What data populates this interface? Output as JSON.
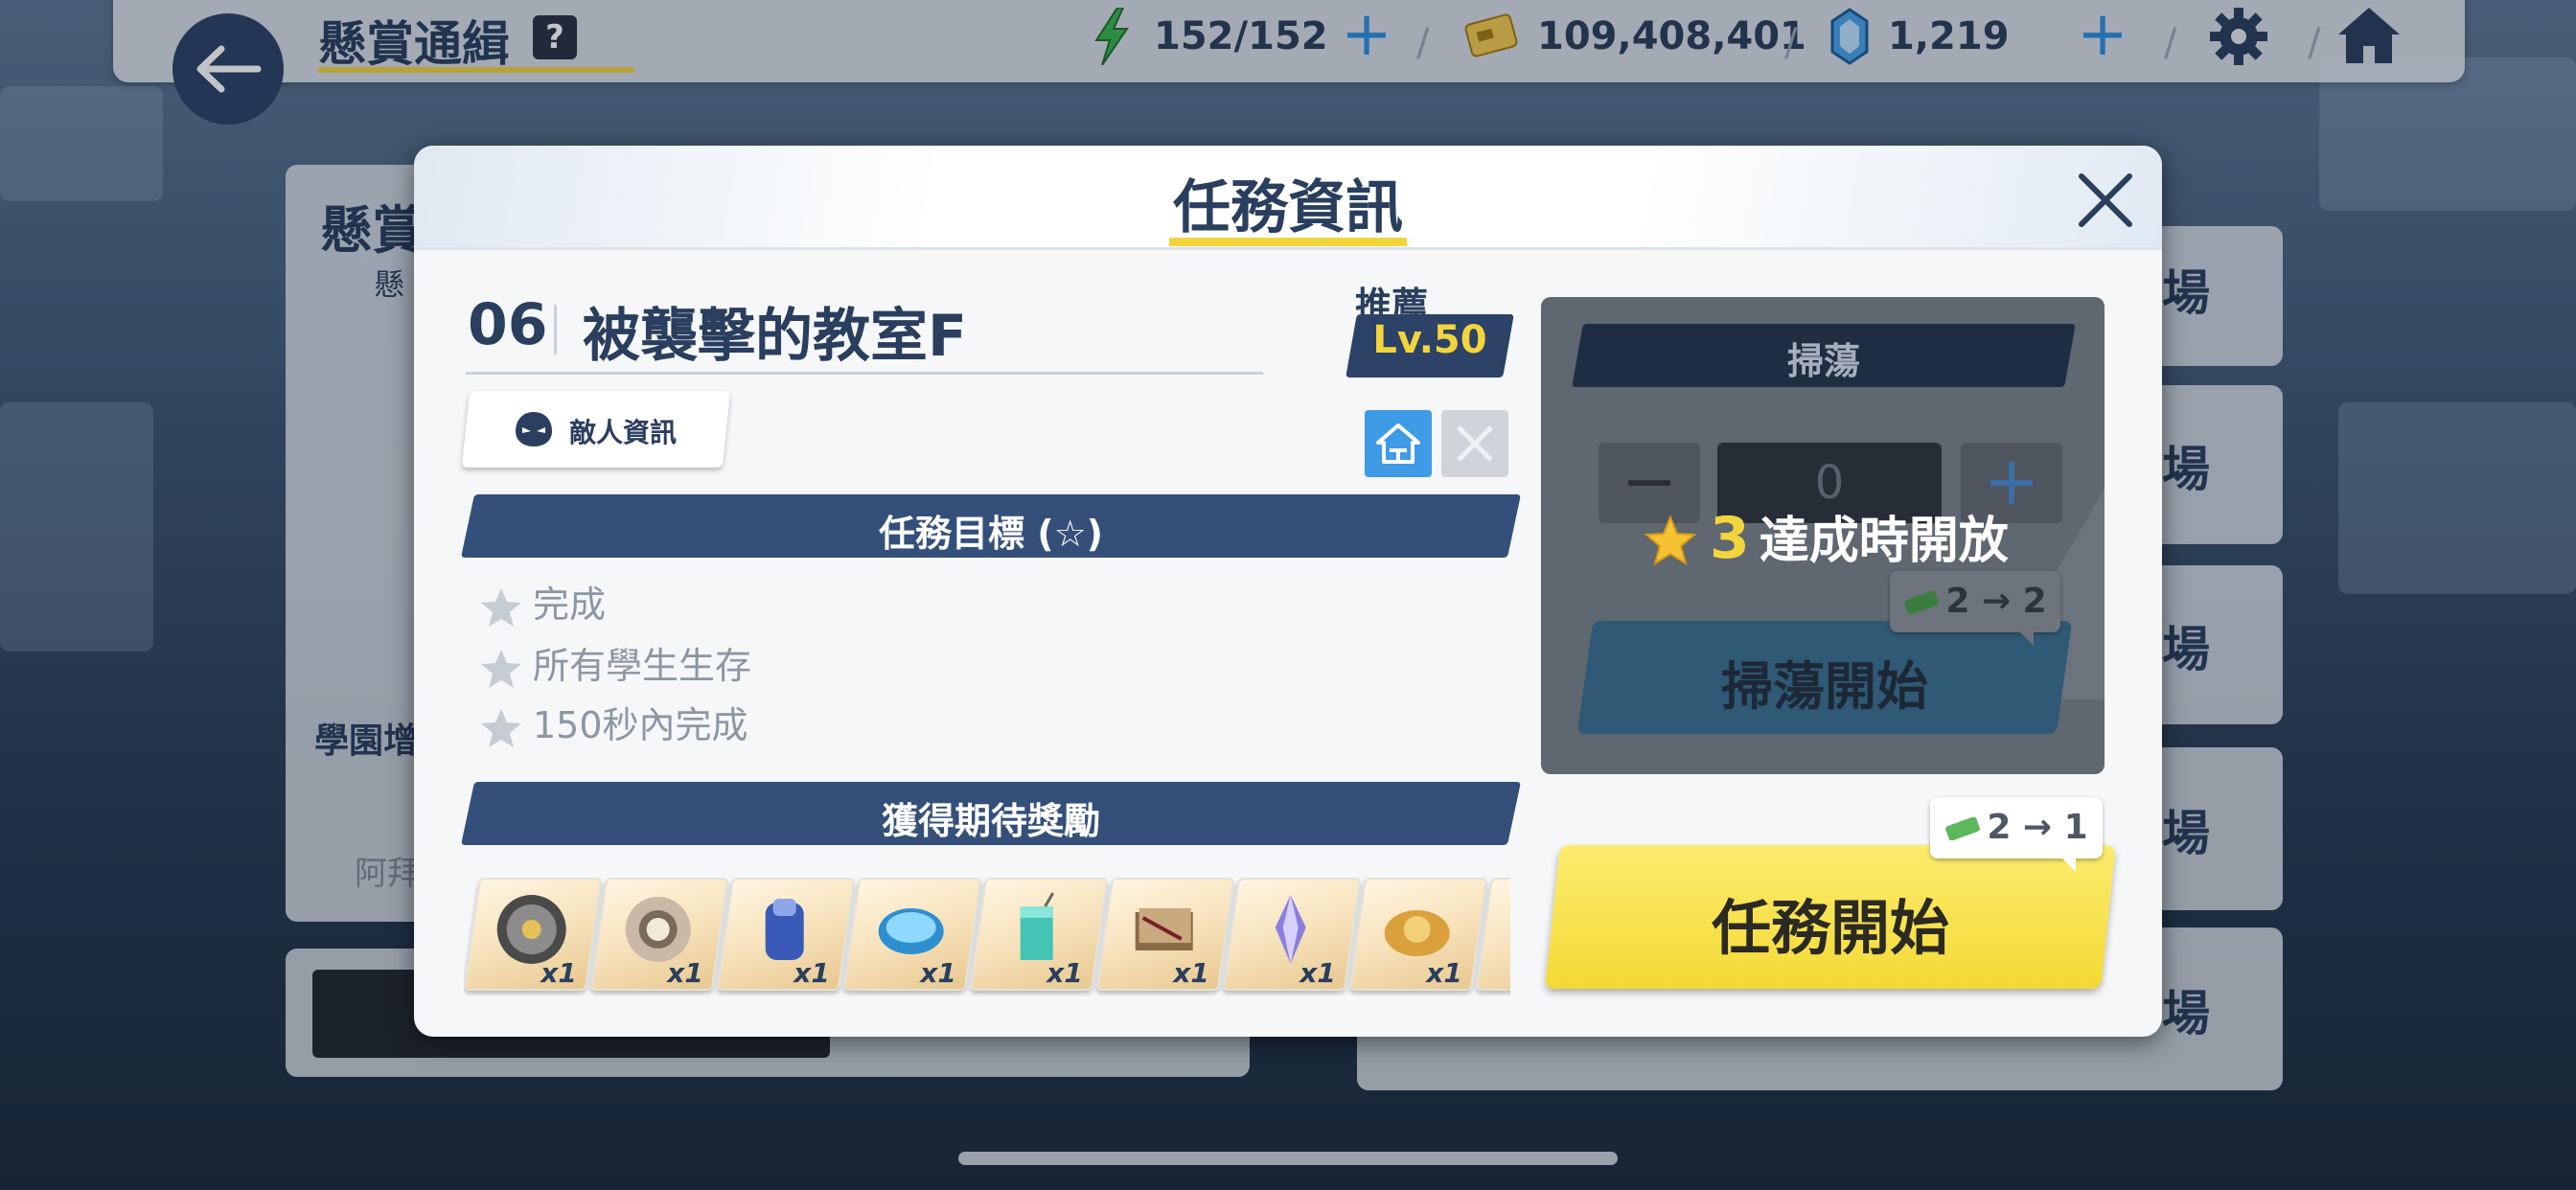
{
  "topbar": {
    "title": "懸賞通緝",
    "help": "?",
    "ap": "152/152",
    "credits": "109,408,401",
    "pyroxene": "1,219"
  },
  "background": {
    "panel_title": "懸賞",
    "panel_sub": "懸",
    "side_label": "學園增",
    "side_sub": "阿拜",
    "right_tabs": [
      "場",
      "場",
      "場",
      "場",
      "場"
    ]
  },
  "modal": {
    "title": "任務資訊",
    "stage_number": "06",
    "stage_name": "被襲擊的教室F",
    "recommended_label": "推薦",
    "recommended_level": "Lv.50",
    "enemy_info": "敵人資訊",
    "objectives_header": "任務目標 (☆)",
    "objectives": [
      "完成",
      "所有學生生存",
      "150秒內完成"
    ],
    "rewards_header": "獲得期待獎勵",
    "rewards": [
      {
        "icon": "gear-disc-icon",
        "qty": "x1"
      },
      {
        "icon": "ring-part-icon",
        "qty": "x1"
      },
      {
        "icon": "blue-bag-icon",
        "qty": "x1"
      },
      {
        "icon": "blue-disc-icon",
        "qty": "x1"
      },
      {
        "icon": "juice-box-icon",
        "qty": "x1"
      },
      {
        "icon": "book-icon",
        "qty": "x1"
      },
      {
        "icon": "crystal-icon",
        "qty": "x1"
      },
      {
        "icon": "gold-ornament-icon",
        "qty": "x1"
      }
    ],
    "sweep": {
      "header": "掃蕩",
      "count": "0",
      "minus": "−",
      "plus": "+",
      "lock_stars": "3",
      "lock_text": "達成時開放",
      "cost_from": "2",
      "cost_to": "2",
      "button": "掃蕩開始"
    },
    "start": {
      "cost_from": "2",
      "cost_to": "1",
      "button": "任務開始"
    }
  },
  "colors": {
    "accent_yellow": "#f2d53c",
    "navy": "#2c4266",
    "banner": "#34507a",
    "blue_button": "#3f9be6"
  }
}
